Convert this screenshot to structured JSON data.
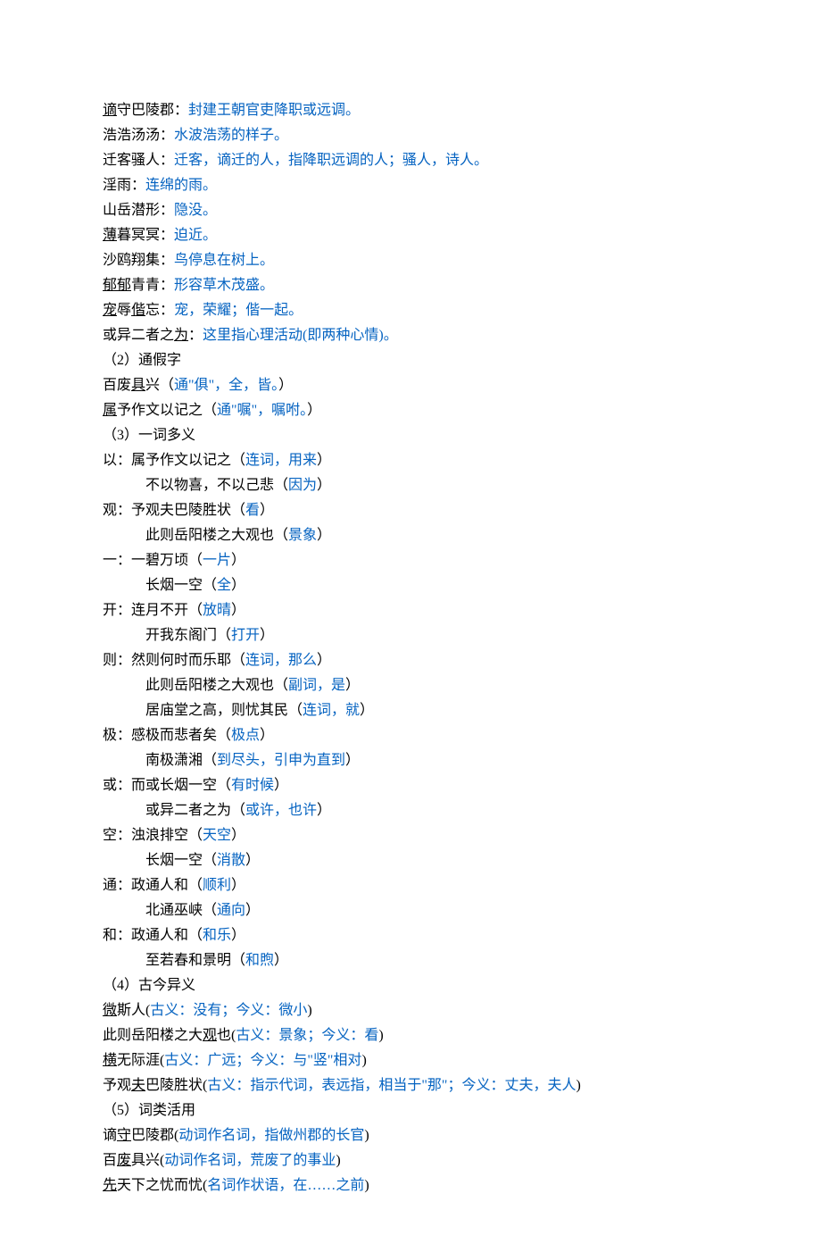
{
  "lines": [
    {
      "segments": [
        {
          "text": "谪",
          "u": true
        },
        {
          "text": "守巴陵郡："
        },
        {
          "text": "封建王朝官吏降职或远调。",
          "blue": true
        }
      ]
    },
    {
      "segments": [
        {
          "text": "浩浩汤汤："
        },
        {
          "text": "水波浩荡的样子。",
          "blue": true
        }
      ]
    },
    {
      "segments": [
        {
          "text": "迁客骚人："
        },
        {
          "text": "迁客，谪迁的人，指降职远调的人；骚人，诗人。",
          "blue": true
        }
      ]
    },
    {
      "segments": [
        {
          "text": "淫雨："
        },
        {
          "text": "连绵的雨。",
          "blue": true
        }
      ]
    },
    {
      "segments": [
        {
          "text": "山岳潜形："
        },
        {
          "text": "隐没。",
          "blue": true
        }
      ]
    },
    {
      "segments": [
        {
          "text": "薄",
          "u": true
        },
        {
          "text": "暮冥冥："
        },
        {
          "text": "迫近。",
          "blue": true
        }
      ]
    },
    {
      "segments": [
        {
          "text": "沙鸥翔集："
        },
        {
          "text": "鸟停息在树上。",
          "blue": true
        }
      ]
    },
    {
      "segments": [
        {
          "text": "郁郁",
          "u": true
        },
        {
          "text": "青青："
        },
        {
          "text": "形容草木茂盛。",
          "blue": true
        }
      ]
    },
    {
      "segments": [
        {
          "text": "宠",
          "u": true
        },
        {
          "text": "辱"
        },
        {
          "text": "偕",
          "u": true
        },
        {
          "text": "忘："
        },
        {
          "text": "宠，荣耀；偕一起。",
          "blue": true
        }
      ]
    },
    {
      "segments": [
        {
          "text": "或异二者之"
        },
        {
          "text": "为",
          "u": true
        },
        {
          "text": "："
        },
        {
          "text": "这里指心理活动(即两种心情)。",
          "blue": true
        }
      ]
    },
    {
      "segments": [
        {
          "text": "（2）通假字"
        }
      ]
    },
    {
      "segments": [
        {
          "text": "百废"
        },
        {
          "text": "具",
          "u": true
        },
        {
          "text": "兴（"
        },
        {
          "text": "通\"俱\"，全，皆。",
          "blue": true
        },
        {
          "text": "）"
        }
      ]
    },
    {
      "segments": [
        {
          "text": "属",
          "u": true
        },
        {
          "text": "予作文以记之（"
        },
        {
          "text": "通\"嘱\"，嘱咐。",
          "blue": true
        },
        {
          "text": "）"
        }
      ]
    },
    {
      "segments": [
        {
          "text": "（3）一词多义"
        }
      ]
    },
    {
      "segments": [
        {
          "text": "以：属予作文以记之（"
        },
        {
          "text": "连词，用来",
          "blue": true
        },
        {
          "text": "）"
        }
      ]
    },
    {
      "indent": true,
      "segments": [
        {
          "text": "不以物喜，不以己悲（"
        },
        {
          "text": "因为",
          "blue": true
        },
        {
          "text": "）"
        }
      ]
    },
    {
      "segments": [
        {
          "text": "观：予观夫巴陵胜状（"
        },
        {
          "text": "看",
          "blue": true
        },
        {
          "text": "）"
        }
      ]
    },
    {
      "indent": true,
      "segments": [
        {
          "text": "此则岳阳楼之大观也（"
        },
        {
          "text": "景象",
          "blue": true
        },
        {
          "text": "）"
        }
      ]
    },
    {
      "segments": [
        {
          "text": "一：一碧万顷（"
        },
        {
          "text": "一片",
          "blue": true
        },
        {
          "text": "）"
        }
      ]
    },
    {
      "indent": true,
      "segments": [
        {
          "text": "长烟一空（"
        },
        {
          "text": "全",
          "blue": true
        },
        {
          "text": "）"
        }
      ]
    },
    {
      "segments": [
        {
          "text": "开：连月不开（"
        },
        {
          "text": "放晴",
          "blue": true
        },
        {
          "text": "）"
        }
      ]
    },
    {
      "indent": true,
      "segments": [
        {
          "text": "开我东阁门（"
        },
        {
          "text": "打开",
          "blue": true
        },
        {
          "text": "）"
        }
      ]
    },
    {
      "segments": [
        {
          "text": "则：然则何时而乐耶（"
        },
        {
          "text": "连词，那么",
          "blue": true
        },
        {
          "text": "）"
        }
      ]
    },
    {
      "indent": true,
      "segments": [
        {
          "text": "此则岳阳楼之大观也（"
        },
        {
          "text": "副词，是",
          "blue": true
        },
        {
          "text": "）"
        }
      ]
    },
    {
      "indent": true,
      "segments": [
        {
          "text": "居庙堂之高，则忧其民（"
        },
        {
          "text": "连词，就",
          "blue": true
        },
        {
          "text": "）"
        }
      ]
    },
    {
      "segments": [
        {
          "text": "极：感极而悲者矣（"
        },
        {
          "text": "极点",
          "blue": true
        },
        {
          "text": "）"
        }
      ]
    },
    {
      "indent": true,
      "segments": [
        {
          "text": "南极潇湘（"
        },
        {
          "text": "到尽头，引申为直到",
          "blue": true
        },
        {
          "text": "）"
        }
      ]
    },
    {
      "segments": [
        {
          "text": "或：而或长烟一空（"
        },
        {
          "text": "有时候",
          "blue": true
        },
        {
          "text": "）"
        }
      ]
    },
    {
      "indent": true,
      "segments": [
        {
          "text": "或异二者之为（"
        },
        {
          "text": "或许，也许",
          "blue": true
        },
        {
          "text": "）"
        }
      ]
    },
    {
      "segments": [
        {
          "text": "空：浊浪排空（"
        },
        {
          "text": "天空",
          "blue": true
        },
        {
          "text": "）"
        }
      ]
    },
    {
      "indent": true,
      "segments": [
        {
          "text": "长烟一空（"
        },
        {
          "text": "消散",
          "blue": true
        },
        {
          "text": "）"
        }
      ]
    },
    {
      "segments": [
        {
          "text": "通：政通人和（"
        },
        {
          "text": "顺利",
          "blue": true
        },
        {
          "text": "）"
        }
      ]
    },
    {
      "indent": true,
      "segments": [
        {
          "text": "北通巫峡（"
        },
        {
          "text": "通向",
          "blue": true
        },
        {
          "text": "）"
        }
      ]
    },
    {
      "segments": [
        {
          "text": "和：政通人和（"
        },
        {
          "text": "和乐",
          "blue": true
        },
        {
          "text": "）"
        }
      ]
    },
    {
      "indent": true,
      "segments": [
        {
          "text": "至若春和景明（"
        },
        {
          "text": "和煦",
          "blue": true
        },
        {
          "text": "）"
        }
      ]
    },
    {
      "segments": [
        {
          "text": "（4）古今异义"
        }
      ]
    },
    {
      "segments": [
        {
          "text": "微",
          "u": true
        },
        {
          "text": "斯人("
        },
        {
          "text": "古义：没有；今义：微小",
          "blue": true
        },
        {
          "text": ")"
        }
      ]
    },
    {
      "segments": [
        {
          "text": "此则岳阳楼之大"
        },
        {
          "text": "观",
          "u": true
        },
        {
          "text": "也("
        },
        {
          "text": "古义：景象；今义：看",
          "blue": true
        },
        {
          "text": ")"
        }
      ]
    },
    {
      "segments": [
        {
          "text": "横",
          "u": true
        },
        {
          "text": "无际涯("
        },
        {
          "text": "古义：广远；今义：与\"竖\"相对",
          "blue": true
        },
        {
          "text": ")"
        }
      ]
    },
    {
      "segments": [
        {
          "text": "予观"
        },
        {
          "text": "夫",
          "u": true
        },
        {
          "text": "巴陵胜状("
        },
        {
          "text": "古义：指示代词，表远指，相当于\"那\"；今义：丈夫，夫人",
          "blue": true
        },
        {
          "text": ")"
        }
      ]
    },
    {
      "segments": [
        {
          "text": "（5）词类活用"
        }
      ]
    },
    {
      "segments": [
        {
          "text": "谪"
        },
        {
          "text": "守",
          "u": true
        },
        {
          "text": "巴陵郡("
        },
        {
          "text": "动词作名词，指做州郡的长官",
          "blue": true
        },
        {
          "text": ")"
        }
      ]
    },
    {
      "segments": [
        {
          "text": "百"
        },
        {
          "text": "废",
          "u": true
        },
        {
          "text": "具兴("
        },
        {
          "text": "动词作名词，荒废了的事业",
          "blue": true
        },
        {
          "text": ")"
        }
      ]
    },
    {
      "segments": [
        {
          "text": "先",
          "u": true
        },
        {
          "text": "天下之忧而忧("
        },
        {
          "text": "名词作状语，在……之前",
          "blue": true
        },
        {
          "text": ")"
        }
      ]
    }
  ]
}
